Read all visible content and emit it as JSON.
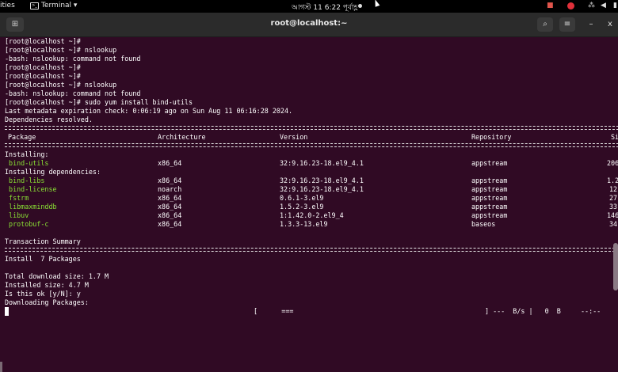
{
  "topbar": {
    "activities": "ities",
    "app_name": "Terminal ▾",
    "clock": "আগস্ট 11  6:22 পূর্বাহ্ণ"
  },
  "window": {
    "title": "root@localhost:~",
    "new_tab_icon": "new-tab-icon",
    "search_icon": "search-icon",
    "menu_icon": "hamburger-menu-icon",
    "minimize_label": "–",
    "close_label": "x"
  },
  "terminal": {
    "lines": [
      "[root@localhost ~]#",
      "[root@localhost ~]# nslookup",
      "-bash: nslookup: command not found",
      "[root@localhost ~]#",
      "[root@localhost ~]#",
      "[root@localhost ~]# nslookup",
      "-bash: nslookup: command not found",
      "[root@localhost ~]# sudo yum install bind-utils",
      "Last metadata expiration check: 0:06:19 ago on Sun Aug 11 06:16:28 2024.",
      "Dependencies resolved."
    ],
    "table_headers": [
      "Package",
      "Architecture",
      "Version",
      "Repository",
      "Si"
    ],
    "installing_label": "Installing:",
    "installing_deps_label": "Installing dependencies:",
    "rows": [
      {
        "name": " bind-utils",
        "arch": "x86_64",
        "version": "32:9.16.23-18.el9_4.1",
        "repo": "appstream",
        "size": "206"
      },
      {
        "name": " bind-libs",
        "arch": "x86_64",
        "version": "32:9.16.23-18.el9_4.1",
        "repo": "appstream",
        "size": "1.2"
      },
      {
        "name": " bind-license",
        "arch": "noarch",
        "version": "32:9.16.23-18.el9_4.1",
        "repo": "appstream",
        "size": "12"
      },
      {
        "name": " fstrm",
        "arch": "x86_64",
        "version": "0.6.1-3.el9",
        "repo": "appstream",
        "size": "27"
      },
      {
        "name": " libmaxminddb",
        "arch": "x86_64",
        "version": "1.5.2-3.el9",
        "repo": "appstream",
        "size": "33"
      },
      {
        "name": " libuv",
        "arch": "x86_64",
        "version": "1:1.42.0-2.el9_4",
        "repo": "appstream",
        "size": "146"
      },
      {
        "name": " protobuf-c",
        "arch": "x86_64",
        "version": "1.3.3-13.el9",
        "repo": "baseos",
        "size": "34"
      }
    ],
    "transaction_summary": "Transaction Summary",
    "install_count": "Install  7 Packages",
    "total_download": "Total download size: 1.7 M",
    "installed_size": "Installed size: 4.7 M",
    "prompt_ok": "Is this ok [y/N]: y",
    "downloading": "Downloading Packages:",
    "progress_left": "[      ===",
    "progress_right": "] ---  B/s |   0  B     --:--"
  },
  "colors": {
    "terminal_bg": "#300a24",
    "package_green": "#8ae234",
    "header_bg": "#2b2b2b"
  }
}
